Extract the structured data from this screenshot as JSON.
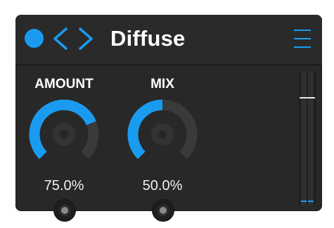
{
  "plugin": {
    "title": "Diffuse",
    "power_on": true
  },
  "icons": {
    "power": "power-dot-icon",
    "prev": "chevron-left-icon",
    "next": "chevron-right-icon",
    "menu": "hamburger-menu-icon",
    "port": "cv-port-icon"
  },
  "knobs": [
    {
      "label": "AMOUNT",
      "value_text": "75.0%",
      "value": 0.75
    },
    {
      "label": "MIX",
      "value_text": "50.0%",
      "value": 0.5
    }
  ],
  "meter": {
    "threshold_level": 0.8,
    "left_level": 0.0,
    "right_level": 0.0
  },
  "colors": {
    "accent": "#1a9bf0",
    "panel": "#282828",
    "track": "#3a3a3a",
    "knob_center": "#333333"
  }
}
